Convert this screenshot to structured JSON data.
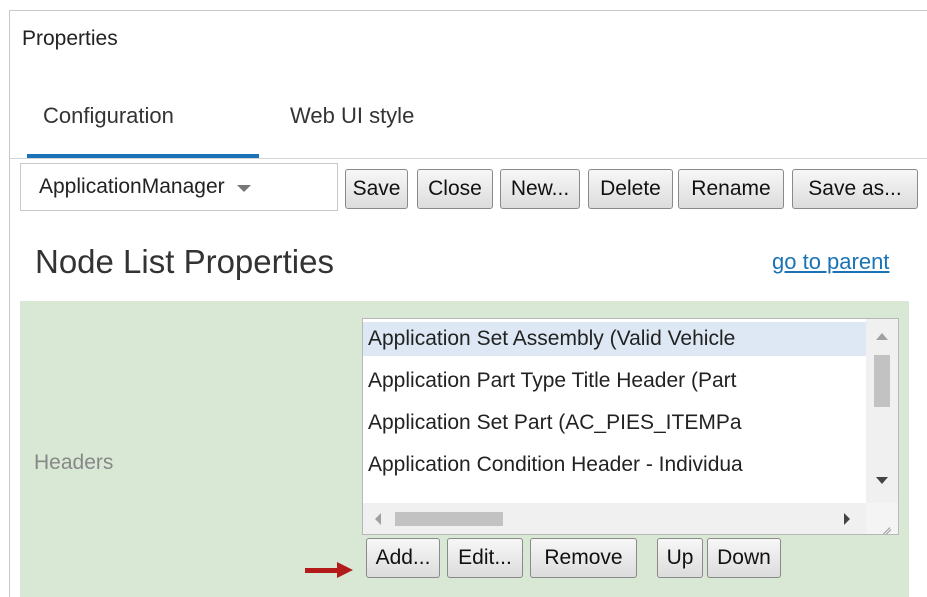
{
  "panel": {
    "title": "Properties"
  },
  "tabs": [
    {
      "label": "Configuration",
      "active": true
    },
    {
      "label": "Web UI style",
      "active": false
    }
  ],
  "toolbar": {
    "config_select": "ApplicationManager",
    "save_label": "Save",
    "close_label": "Close",
    "new_label": "New...",
    "delete_label": "Delete",
    "rename_label": "Rename",
    "save_as_label": "Save as..."
  },
  "section": {
    "title": "Node List Properties",
    "parent_link": "go to parent"
  },
  "headers": {
    "label": "Headers",
    "items": [
      {
        "label": "Application Set Assembly (Valid Vehicle",
        "selected": true
      },
      {
        "label": "Application Part Type Title Header (Part",
        "selected": false
      },
      {
        "label": "Application Set Part (AC_PIES_ITEMPa",
        "selected": false
      },
      {
        "label": "Application Condition Header - Individua",
        "selected": false
      }
    ],
    "add_label": "Add...",
    "edit_label": "Edit...",
    "remove_label": "Remove",
    "up_label": "Up",
    "down_label": "Down"
  },
  "colors": {
    "accent": "#1a73b6",
    "section_background": "#d8e8d4",
    "selection": "#dde8f4",
    "callout_arrow": "#b31b1b"
  }
}
